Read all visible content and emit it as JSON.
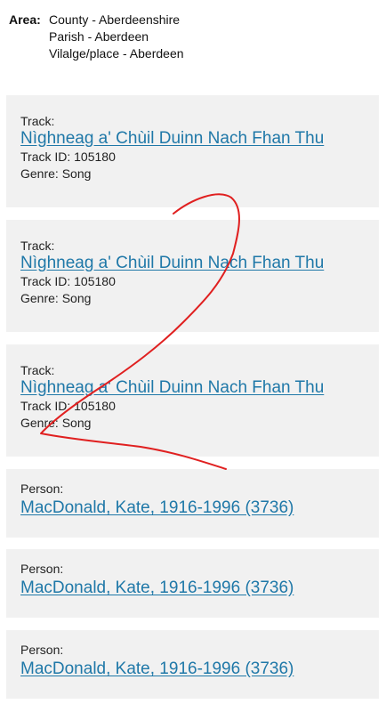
{
  "area": {
    "label": "Area:",
    "county": "County - Aberdeenshire",
    "parish": "Parish - Aberdeen",
    "place": "Vilalge/place - Aberdeen"
  },
  "tracks": [
    {
      "label": "Track:",
      "title": "Nìghneag a' Chùil Duinn Nach Fhan Thu",
      "track_id": "Track ID: 105180",
      "genre": "Genre: Song"
    },
    {
      "label": "Track:",
      "title": "Nìghneag a' Chùil Duinn Nach Fhan Thu",
      "track_id": "Track ID: 105180",
      "genre": "Genre: Song"
    },
    {
      "label": "Track:",
      "title": "Nìghneag a' Chùil Duinn Nach Fhan Thu",
      "track_id": "Track ID: 105180",
      "genre": "Genre: Song"
    }
  ],
  "persons": [
    {
      "label": "Person:",
      "name": "MacDonald, Kate, 1916-1996 (3736)"
    },
    {
      "label": "Person:",
      "name": "MacDonald, Kate, 1916-1996 (3736)"
    },
    {
      "label": "Person:",
      "name": "MacDonald, Kate, 1916-1996 (3736)"
    }
  ],
  "colors": {
    "card_background": "#f1f1f1",
    "link": "#1f78a8",
    "annotation": "#e02020"
  },
  "annotation": {
    "kind": "hand-drawn-digit",
    "text": "2"
  }
}
